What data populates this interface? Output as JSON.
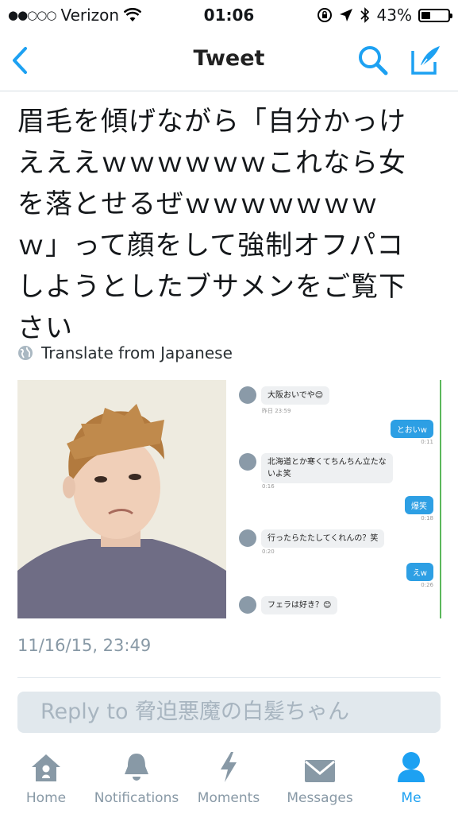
{
  "status_bar": {
    "signal_dots": "●●○○○",
    "carrier": "Verizon",
    "time": "01:06",
    "battery": "43%",
    "battery_level": 0.43
  },
  "nav": {
    "title": "Tweet",
    "back_icon": "chevron-left-icon",
    "search_icon": "search-icon",
    "compose_icon": "compose-icon",
    "accent": "#1da1f2"
  },
  "tweet": {
    "lines": [
      "眉毛を傾げながら「自分かっけ",
      "えええｗｗｗｗｗｗこれなら女",
      "を落とせるぜｗｗｗｗｗｗｗ",
      "ｗ」って顔をして強制オフパコ",
      "しようとしたブサメンをご覧下",
      "さい"
    ],
    "translate_label": "Translate from Japanese",
    "date": "11/16/15, 23:49"
  },
  "chat": {
    "m1": "大阪おいでや😊",
    "m1_time": "昨日 23:59",
    "o1": "とおいw",
    "o1_time": "0:11",
    "m2": "北海道とか寒くてちんちん立たないよ笑",
    "m2_time": "0:16",
    "o2": "爆笑",
    "o2_time": "0:18",
    "m3": "行ったらたたしてくれんの？笑",
    "m3_time": "0:20",
    "o3": "えw",
    "o3_time": "0:26",
    "m4": "フェラは好き？😊"
  },
  "reply": {
    "placeholder": "Reply to 脅迫悪魔の白髪ちゃん"
  },
  "tabs": [
    {
      "label": "Home",
      "icon": "home-icon"
    },
    {
      "label": "Notifications",
      "icon": "bell-icon"
    },
    {
      "label": "Moments",
      "icon": "lightning-icon"
    },
    {
      "label": "Messages",
      "icon": "envelope-icon"
    },
    {
      "label": "Me",
      "icon": "person-icon"
    }
  ]
}
